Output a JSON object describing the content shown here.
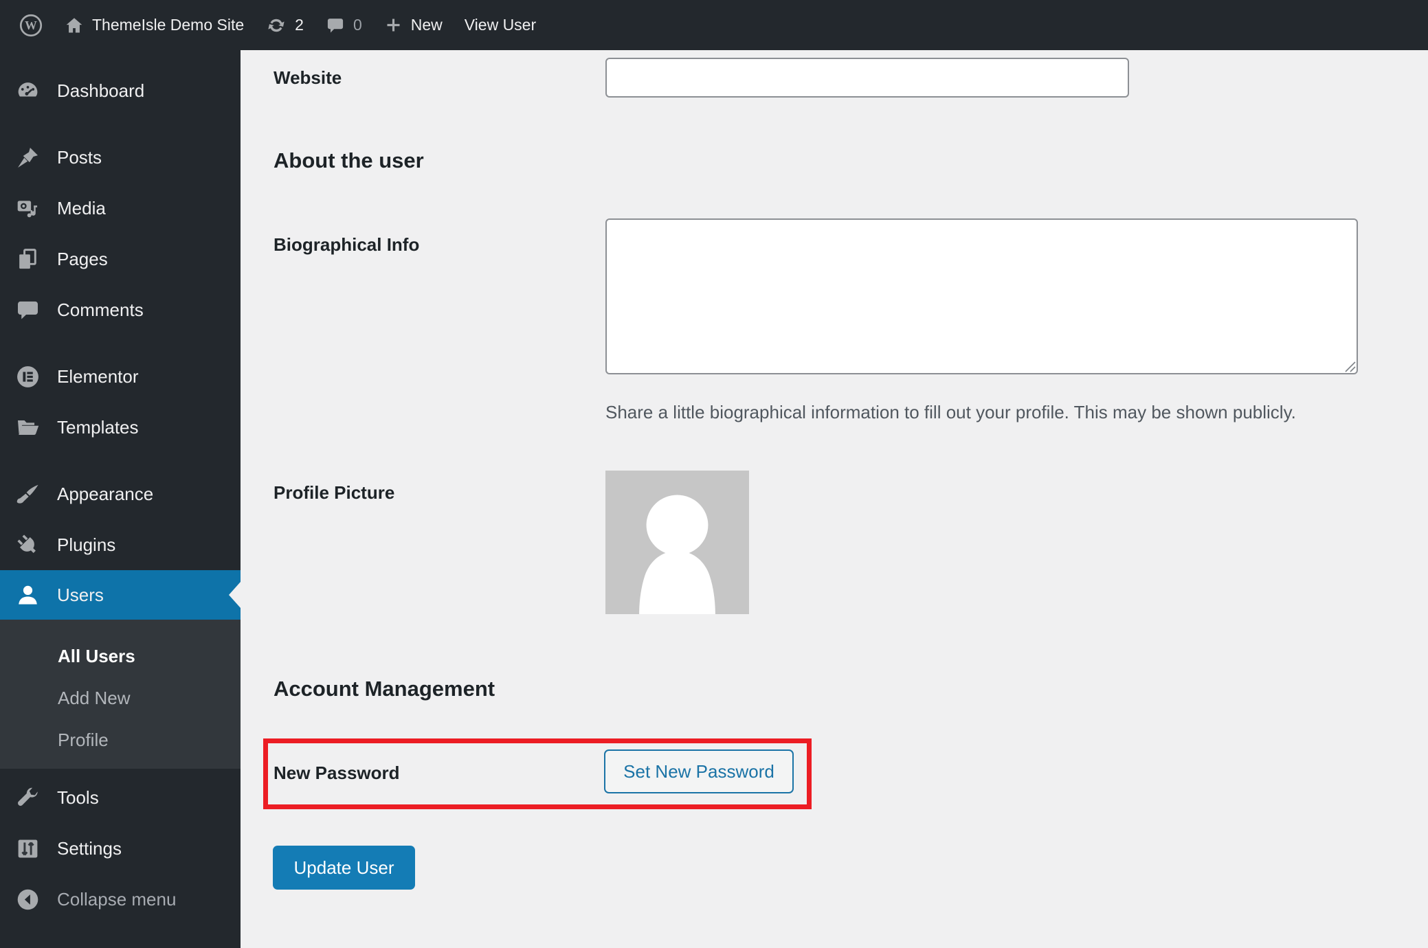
{
  "admin_bar": {
    "site_name": "ThemeIsle Demo Site",
    "updates_count": "2",
    "comments_count": "0",
    "new_label": "New",
    "view_user_label": "View User"
  },
  "sidebar": {
    "active_item": "Users",
    "items": [
      {
        "label": "Dashboard",
        "icon": "dashboard-icon"
      },
      {
        "label": "Posts",
        "icon": "pin-icon"
      },
      {
        "label": "Media",
        "icon": "media-icon"
      },
      {
        "label": "Pages",
        "icon": "pages-icon"
      },
      {
        "label": "Comments",
        "icon": "comment-icon"
      },
      {
        "label": "Elementor",
        "icon": "elementor-icon"
      },
      {
        "label": "Templates",
        "icon": "folder-icon"
      },
      {
        "label": "Appearance",
        "icon": "paintbrush-icon"
      },
      {
        "label": "Plugins",
        "icon": "plug-icon"
      },
      {
        "label": "Users",
        "icon": "user-icon"
      },
      {
        "label": "Tools",
        "icon": "wrench-icon"
      },
      {
        "label": "Settings",
        "icon": "sliders-icon"
      },
      {
        "label": "Collapse menu",
        "icon": "collapse-icon"
      }
    ],
    "users_submenu": [
      {
        "label": "All Users",
        "current": true
      },
      {
        "label": "Add New",
        "current": false
      },
      {
        "label": "Profile",
        "current": false
      }
    ]
  },
  "form": {
    "website": {
      "label": "Website",
      "value": ""
    },
    "about_heading": "About the user",
    "bio": {
      "label": "Biographical Info",
      "value": "",
      "description": "Share a little biographical information to fill out your profile. This may be shown publicly."
    },
    "profile_picture_label": "Profile Picture",
    "account_heading": "Account Management",
    "new_password_label": "New Password",
    "set_new_password_button": "Set New Password",
    "update_user_button": "Update User"
  },
  "colors": {
    "admin_dark": "#23282d",
    "submenu_dark": "#32373c",
    "active_menu_blue": "#0e73a9",
    "primary_button_blue": "#147cb5",
    "secondary_button_blue": "#1a73a6",
    "annotation_red": "#ec1d24",
    "page_background": "#f0f0f1"
  }
}
